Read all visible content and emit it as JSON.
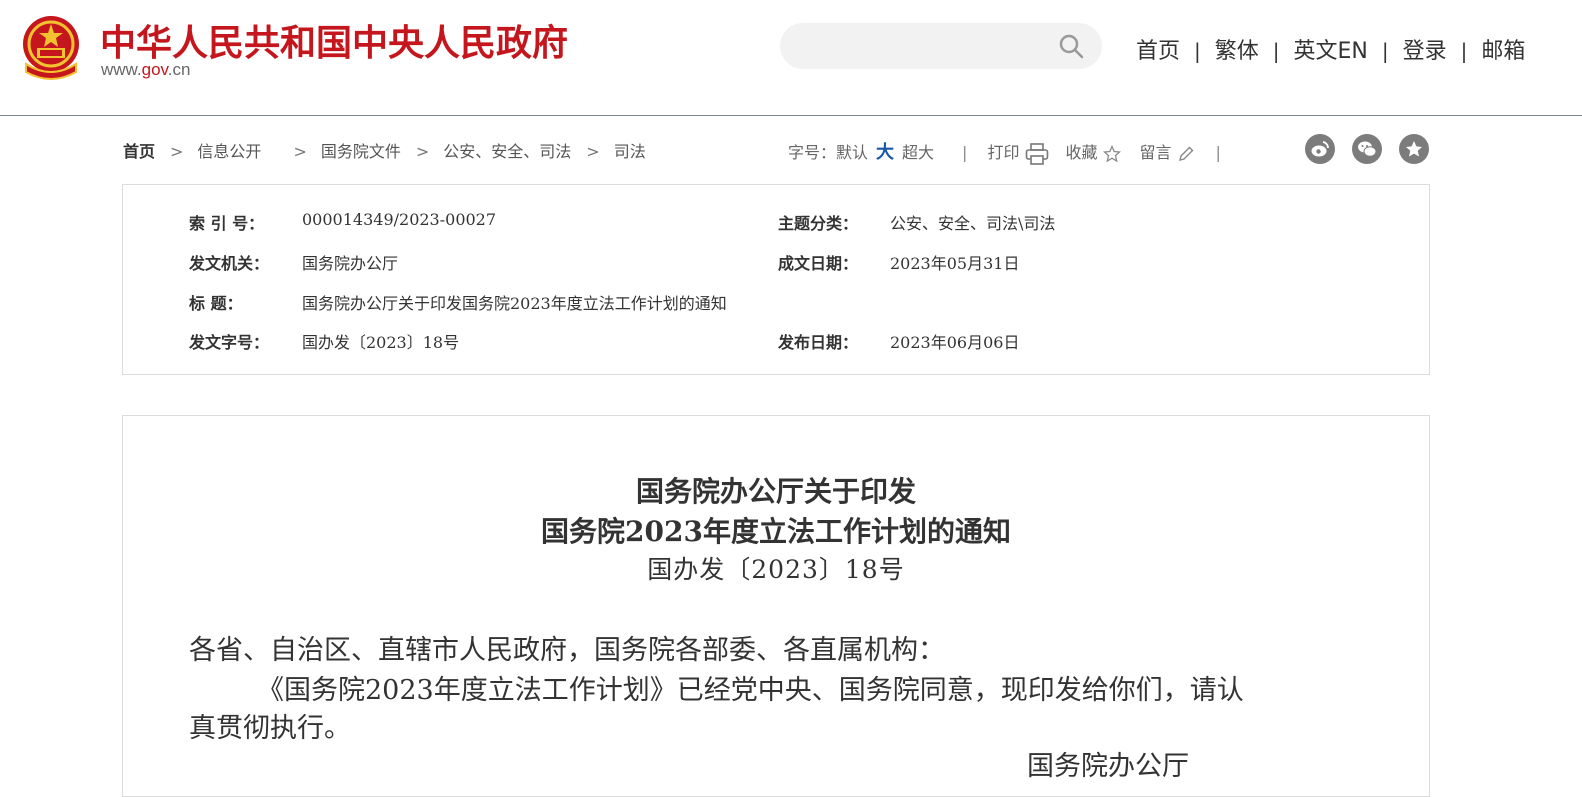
{
  "header": {
    "site_title": "中华人民共和国中央人民政府",
    "site_url_pre": "www.",
    "site_url_mid": "gov",
    "site_url_post": ".cn",
    "search_placeholder": "",
    "nav": [
      "首页",
      "繁体",
      "英文EN",
      "登录",
      "邮箱"
    ]
  },
  "breadcrumb": {
    "items": [
      "首页",
      "信息公开",
      "国务院文件",
      "公安、安全、司法",
      "司法"
    ],
    "separator": ">"
  },
  "tools": {
    "font_label": "字号：",
    "font_default": "默认",
    "font_big": "大",
    "font_bigger": "超大",
    "divider": "|",
    "print": "打印",
    "favorite": "收藏",
    "comment": "留言"
  },
  "share": [
    "weibo-icon",
    "wechat-icon",
    "favorite-star-icon"
  ],
  "meta": {
    "index_label": "索  引  号：",
    "index_value": "000014349/2023-00027",
    "topic_label": "主题分类：",
    "topic_value": "公安、安全、司法\\司法",
    "issuer_label": "发文机关：",
    "issuer_value": "国务院办公厅",
    "created_label": "成文日期：",
    "created_value": "2023年05月31日",
    "title_label": "标      题：",
    "title_value": "国务院办公厅关于印发国务院2023年度立法工作计划的通知",
    "docno_label": "发文字号：",
    "docno_value": "国办发〔2023〕18号",
    "published_label": "发布日期：",
    "published_value": "2023年06月06日"
  },
  "document": {
    "title_line1": "国务院办公厅关于印发",
    "title_line2": "国务院2023年度立法工作计划的通知",
    "doc_number": "国办发〔2023〕18号",
    "salutation": "各省、自治区、直辖市人民政府，国务院各部委、各直属机构：",
    "para1_line1": "《国务院2023年度立法工作计划》已经党中央、国务院同意，现印发给你们，请认",
    "para1_line2": "真贯彻执行。",
    "signature": "国务院办公厅"
  },
  "colors": {
    "brand_red": "#c4161c",
    "link_blue": "#1a57a8",
    "icon_gray": "#7c7c7c"
  }
}
